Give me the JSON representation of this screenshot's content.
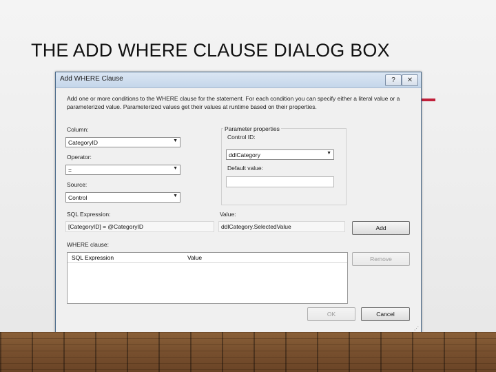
{
  "slide": {
    "title": "THE ADD WHERE CLAUSE DIALOG BOX"
  },
  "dialog": {
    "title": "Add WHERE Clause",
    "help_label": "?",
    "close_label": "✕",
    "description": "Add one or more conditions to the WHERE clause for the statement. For each condition you can specify either a literal value or a parameterized value. Parameterized values get their values at runtime based on their properties.",
    "column": {
      "label": "Column:",
      "value": "CategoryID"
    },
    "operator": {
      "label": "Operator:",
      "value": "="
    },
    "source": {
      "label": "Source:",
      "value": "Control"
    },
    "parameter_properties": {
      "label": "Parameter properties",
      "control_id": {
        "label": "Control ID:",
        "value": "ddlCategory"
      },
      "default_value": {
        "label": "Default value:",
        "value": ""
      }
    },
    "sql_expression": {
      "label": "SQL Expression:",
      "value": "[CategoryID] = @CategoryID"
    },
    "value": {
      "label": "Value:",
      "value": "ddlCategory.SelectedValue"
    },
    "add_label": "Add",
    "where_clause": {
      "label": "WHERE clause:",
      "columns": [
        "SQL Expression",
        "Value"
      ]
    },
    "remove_label": "Remove",
    "ok_label": "OK",
    "cancel_label": "Cancel",
    "resize_glyph": "⋰"
  },
  "colors": {
    "accent": "#c0203a",
    "titlebar": "#c4d6ea",
    "dialog_bg": "#f0f0f0"
  }
}
